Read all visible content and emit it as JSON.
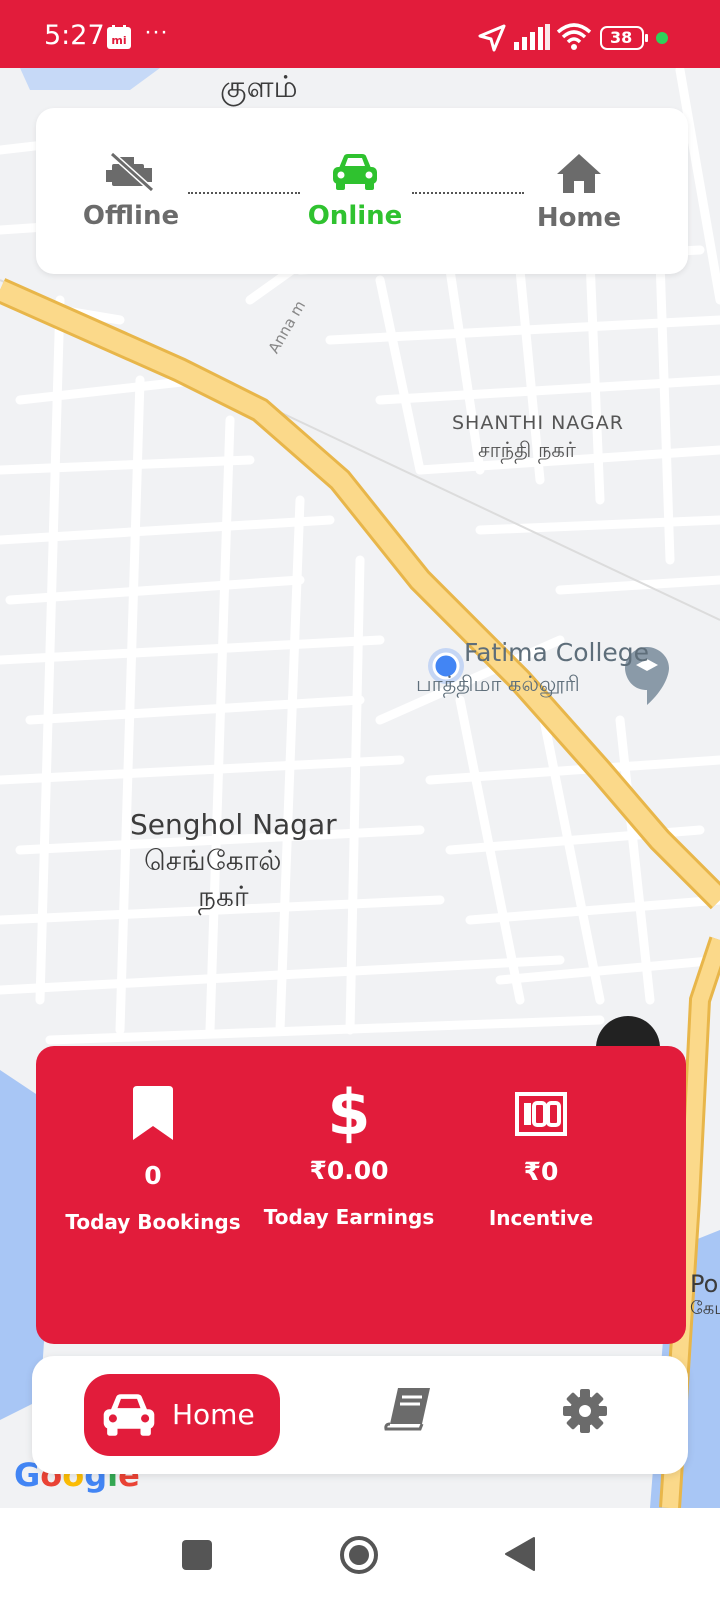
{
  "status_bar": {
    "time": "5:27",
    "more": "···",
    "battery": "38"
  },
  "map": {
    "labels": {
      "kulam": "குளம்",
      "anna": "Anna m",
      "shanthi_en": "SHANTHI NAGAR",
      "shanthi_ta": "சாந்தி நகர்",
      "fatima_en": "Fatima College",
      "fatima_ta": "பாத்திமா கல்லூரி",
      "senghol_en": "Senghol Nagar",
      "senghol_ta1": "செங்கோல்",
      "senghol_ta2": "நகர்",
      "edge_po": "Po",
      "edge_ta": "கேட"
    },
    "google": "Google"
  },
  "driver_status": {
    "steps": [
      {
        "label": "Offline",
        "icon": "engine-off-icon",
        "color": "#6b6b6b"
      },
      {
        "label": "Online",
        "icon": "car-icon",
        "color": "#2fc22f"
      },
      {
        "label": "Home",
        "icon": "home-icon",
        "color": "#6b6b6b"
      }
    ],
    "active": "Online"
  },
  "stats": [
    {
      "icon": "bookmark-icon",
      "value": "0",
      "label": "Today Bookings"
    },
    {
      "icon": "dollar-icon",
      "value": "₹0.00",
      "label": "Today Earnings"
    },
    {
      "icon": "incentive-100-icon",
      "value": "₹0",
      "label": "Incentive"
    }
  ],
  "bottom_nav": {
    "home_label": "Home",
    "items": [
      "home-car-icon",
      "book-icon",
      "settings-icon"
    ]
  },
  "colors": {
    "accent": "#e21c3b",
    "online": "#2fc22f",
    "inactive": "#6b6b6b",
    "road_major": "#fbd98a"
  }
}
